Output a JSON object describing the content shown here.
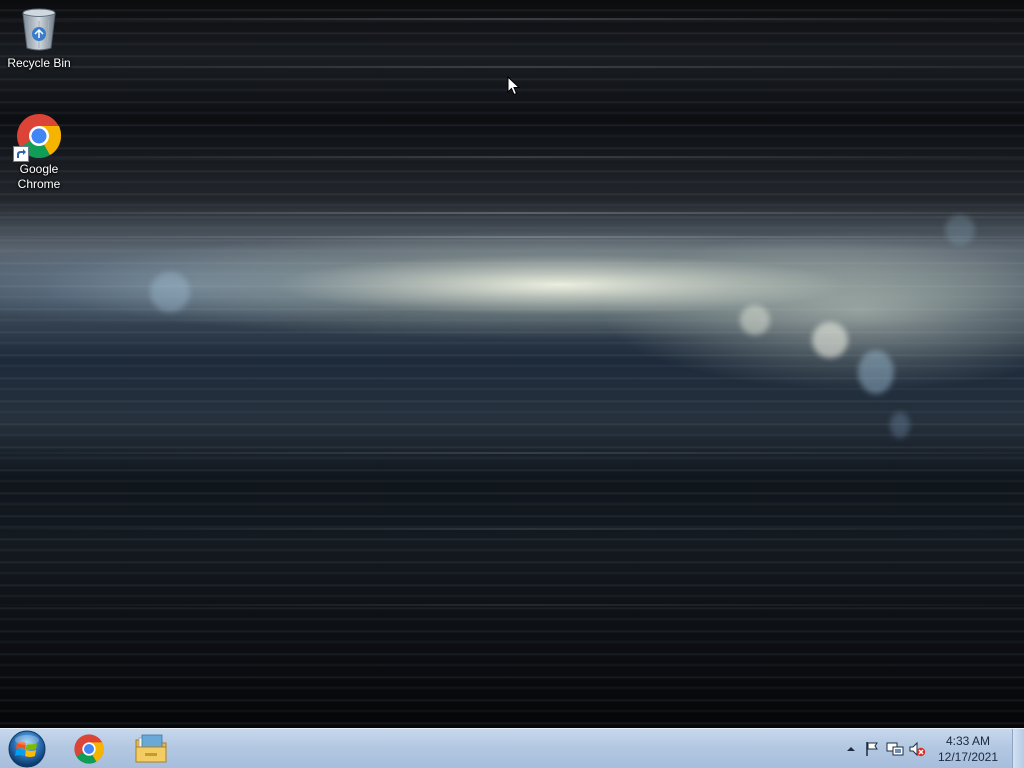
{
  "desktop": {
    "icons": [
      {
        "label": "Recycle Bin",
        "icon": "recycle-bin-icon"
      },
      {
        "label": "Google\nChrome",
        "label_line1": "Google",
        "label_line2": "Chrome",
        "icon": "chrome-icon"
      }
    ]
  },
  "taskbar": {
    "start_icon": "windows-logo-icon",
    "pinned": [
      {
        "name": "Google Chrome",
        "icon": "chrome-icon"
      },
      {
        "name": "Windows Explorer",
        "icon": "folder-icon"
      }
    ],
    "tray": {
      "icons": [
        "show-hidden-icons-arrow",
        "action-center-flag-icon",
        "network-icon",
        "volume-muted-icon"
      ],
      "time": "4:33 AM",
      "date": "12/17/2021"
    }
  },
  "colors": {
    "taskbar": "#b3c8e2",
    "wallpaper_dark": "#07090d",
    "wallpaper_light": "#e8ecd8"
  }
}
